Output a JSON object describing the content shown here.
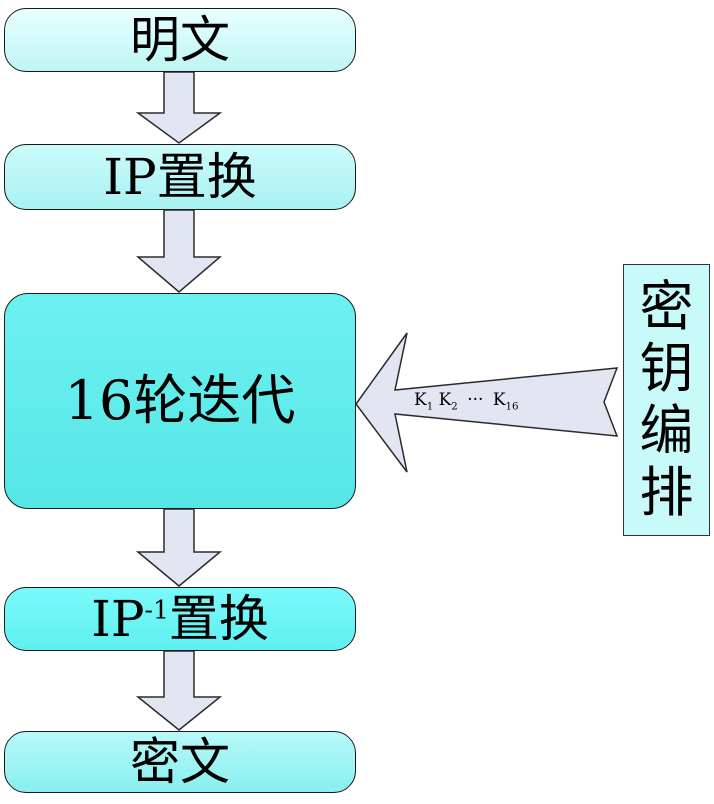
{
  "nodes": {
    "plaintext": "明文",
    "ip_prefix": "IP",
    "ip_suffix": "置换",
    "rounds": "16轮迭代",
    "ip_inv_prefix": "IP",
    "ip_inv_sup": "-1",
    "ip_inv_suffix": "置换",
    "ciphertext": "密文"
  },
  "key_schedule": {
    "chars": [
      "密",
      "钥",
      "编",
      "排"
    ]
  },
  "subkeys": {
    "k1_letter": "K",
    "k1_sub": "1",
    "k2_letter": "K",
    "k2_sub": "2",
    "ellipsis": "···",
    "k16_letter": "K",
    "k16_sub": "16"
  },
  "colors": {
    "arrow_fill": "#e2e6f3",
    "arrow_stroke": "#2b2b2b"
  }
}
